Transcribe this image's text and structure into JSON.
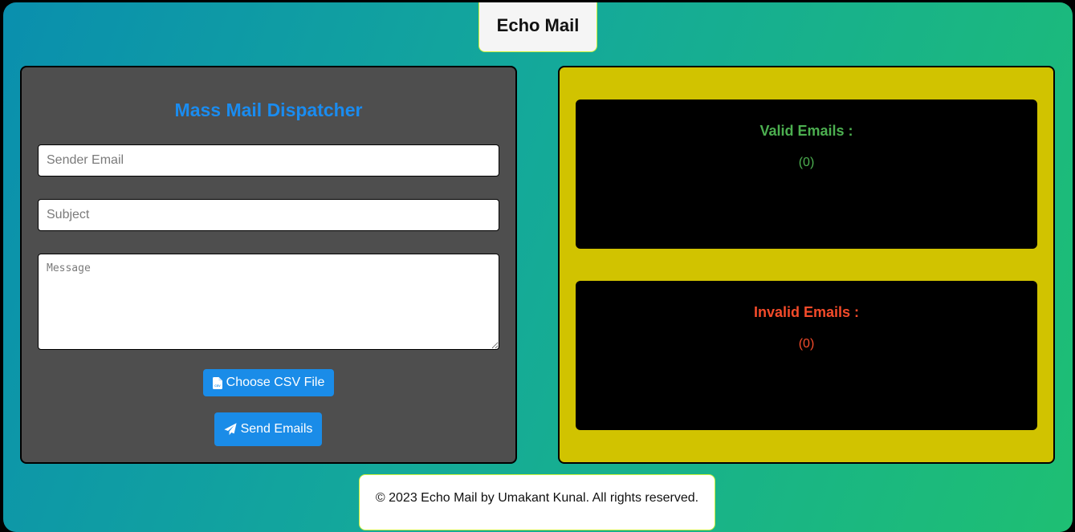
{
  "header": {
    "title": "Echo Mail"
  },
  "form": {
    "title": "Mass Mail Dispatcher",
    "sender_placeholder": "Sender Email",
    "subject_placeholder": "Subject",
    "message_placeholder": "Message",
    "csv_button_label": "Choose CSV File",
    "csv_button_icon": "file-csv-icon",
    "send_button_label": "Send Emails",
    "send_button_icon": "paper-plane-icon"
  },
  "results": {
    "valid": {
      "heading": "Valid Emails :",
      "count": "(0)"
    },
    "invalid": {
      "heading": "Invalid Emails :",
      "count": "(0)"
    }
  },
  "footer": {
    "text": "© 2023 Echo Mail by Umakant Kunal. All rights reserved."
  },
  "colors": {
    "accent_blue": "#1a8ce8",
    "title_blue": "#1a8cf0",
    "form_panel_bg": "#4e4e4e",
    "results_panel_bg": "#d1c300",
    "valid_green": "#4caf50",
    "invalid_red": "#f44b2a",
    "gradient_start": "#0a8fae",
    "gradient_end": "#1ebf73"
  }
}
